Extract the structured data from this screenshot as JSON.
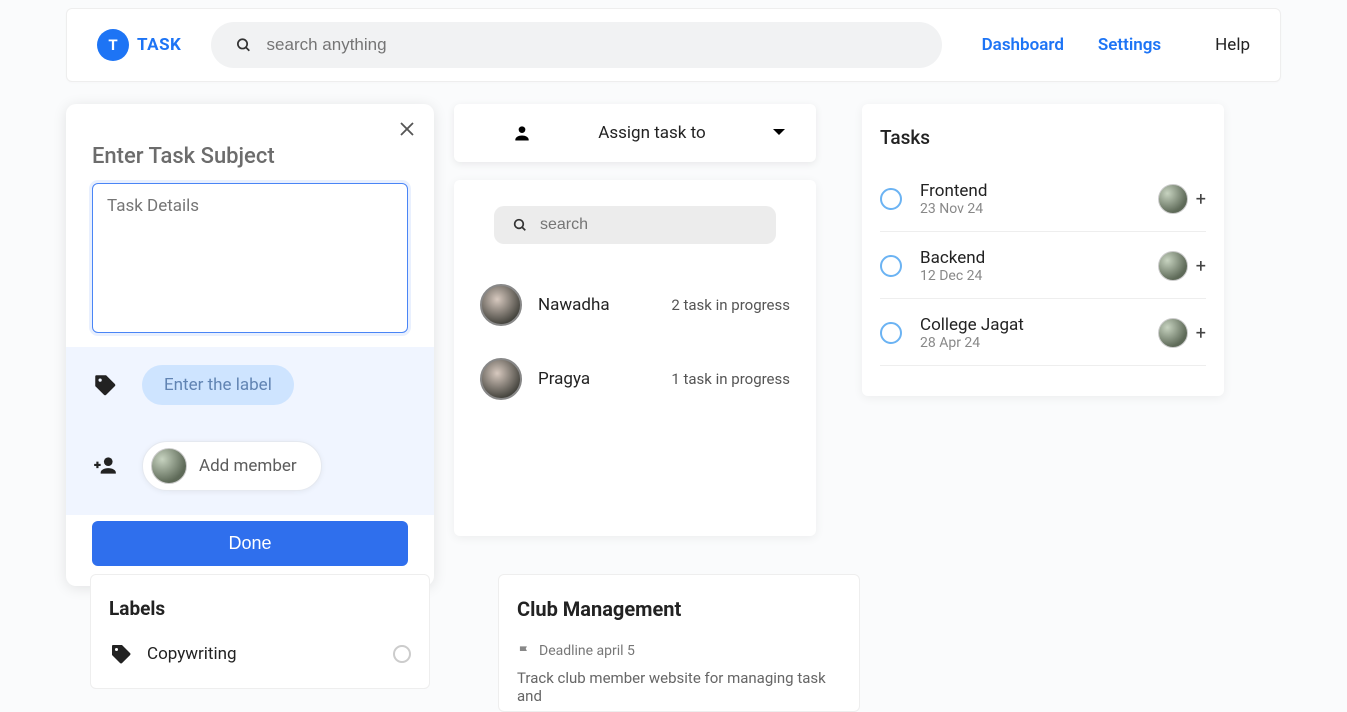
{
  "header": {
    "logo_badge": "T",
    "logo_text": "TASK",
    "search_placeholder": "search anything",
    "nav": {
      "dashboard": "Dashboard",
      "settings": "Settings",
      "help": "Help"
    }
  },
  "task_form": {
    "title": "Enter Task Subject",
    "details_placeholder": "Task Details",
    "label_placeholder": "Enter the label",
    "add_member": "Add member",
    "done": "Done"
  },
  "assign": {
    "dropdown_label": "Assign task to",
    "search_placeholder": "search",
    "people": [
      {
        "name": "Nawadha",
        "meta": "2 task in progress"
      },
      {
        "name": "Pragya",
        "meta": "1 task in progress"
      }
    ]
  },
  "tasks": {
    "heading": "Tasks",
    "items": [
      {
        "name": "Frontend",
        "date": "23 Nov 24"
      },
      {
        "name": "Backend",
        "date": "12 Dec 24"
      },
      {
        "name": "College Jagat",
        "date": "28 Apr 24"
      }
    ]
  },
  "labels": {
    "heading": "Labels",
    "items": [
      "Copywriting"
    ]
  },
  "club": {
    "heading": "Club Management",
    "deadline": "Deadline april 5",
    "desc": "Track club member website for managing task and"
  }
}
